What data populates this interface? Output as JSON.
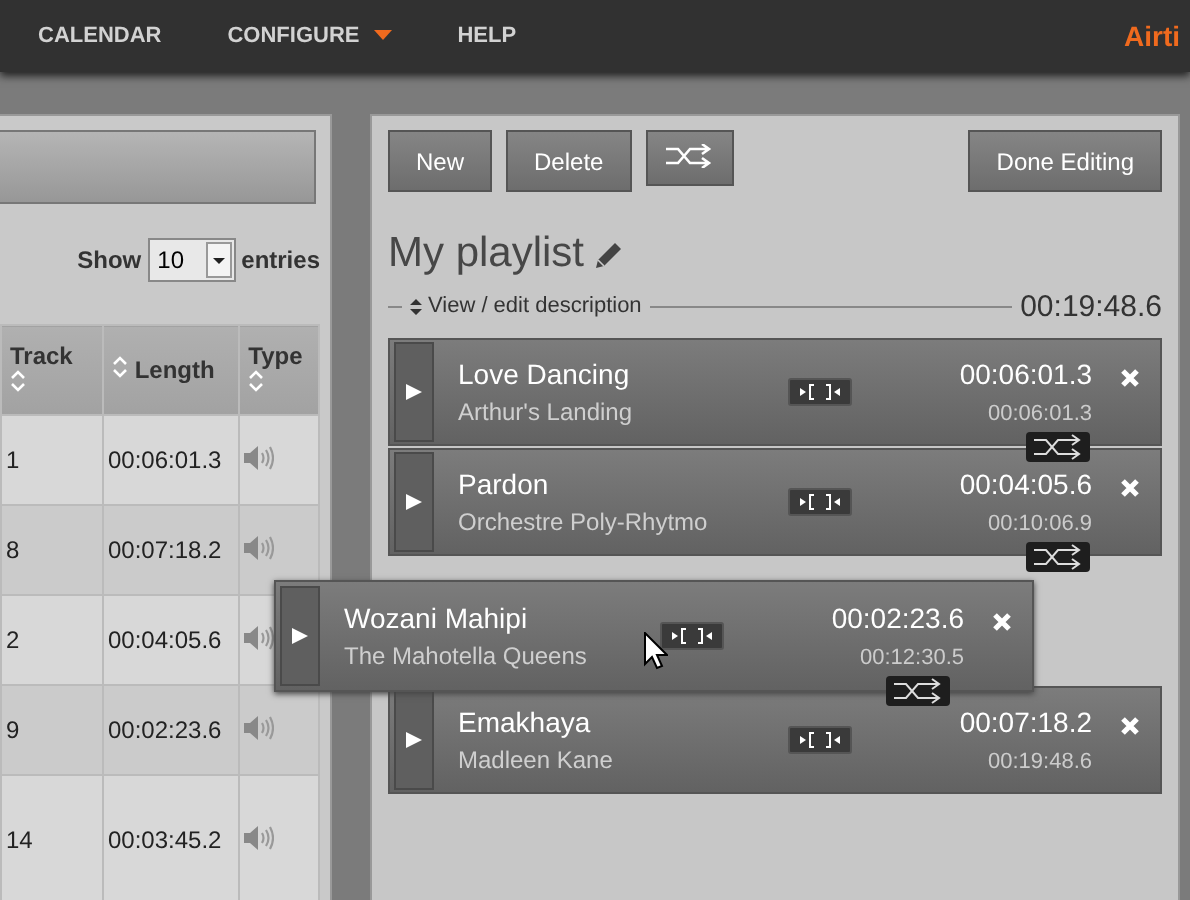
{
  "nav": {
    "items": [
      {
        "label": "CALENDAR",
        "dropdown": false
      },
      {
        "label": "CONFIGURE",
        "dropdown": true
      },
      {
        "label": "HELP",
        "dropdown": false
      }
    ],
    "brand": "Airti"
  },
  "library": {
    "show_label": "Show",
    "page_size": "10",
    "entries_label": "entries",
    "columns": [
      {
        "label": "Track"
      },
      {
        "label": "Length"
      },
      {
        "label": "Type"
      }
    ],
    "rows": [
      {
        "track": "1",
        "length": "00:06:01.3"
      },
      {
        "track": "8",
        "length": "00:07:18.2"
      },
      {
        "track": "2",
        "length": "00:04:05.6"
      },
      {
        "track": "9",
        "length": "00:02:23.6"
      },
      {
        "track": "14",
        "length": "00:03:45.2"
      }
    ]
  },
  "playlist": {
    "buttons": [
      {
        "kind": "text",
        "label": "New"
      },
      {
        "kind": "text",
        "label": "Delete"
      },
      {
        "kind": "shuffle"
      }
    ],
    "done_button": "Done Editing",
    "title": "My playlist",
    "description_toggle": "View / edit description",
    "total_length": "00:19:48.6",
    "items": [
      {
        "kind": "track",
        "title": "Love Dancing",
        "artist": "Arthur's Landing",
        "length": "00:06:01.3",
        "running_total": "00:06:01.3",
        "crossfade": true
      },
      {
        "kind": "track",
        "title": "Pardon",
        "artist": "Orchestre Poly-Rhytmo",
        "length": "00:04:05.6",
        "running_total": "00:10:06.9",
        "crossfade": true
      },
      {
        "kind": "placeholder"
      },
      {
        "kind": "track",
        "title": "Emakhaya",
        "artist": "Madleen Kane",
        "length": "00:07:18.2",
        "running_total": "00:19:48.6",
        "crossfade": false
      }
    ],
    "dragged": {
      "title": "Wozani Mahipi",
      "artist": "The Mahotella Queens",
      "length": "00:02:23.6",
      "running_total": "00:12:30.5",
      "crossfade": true
    }
  }
}
